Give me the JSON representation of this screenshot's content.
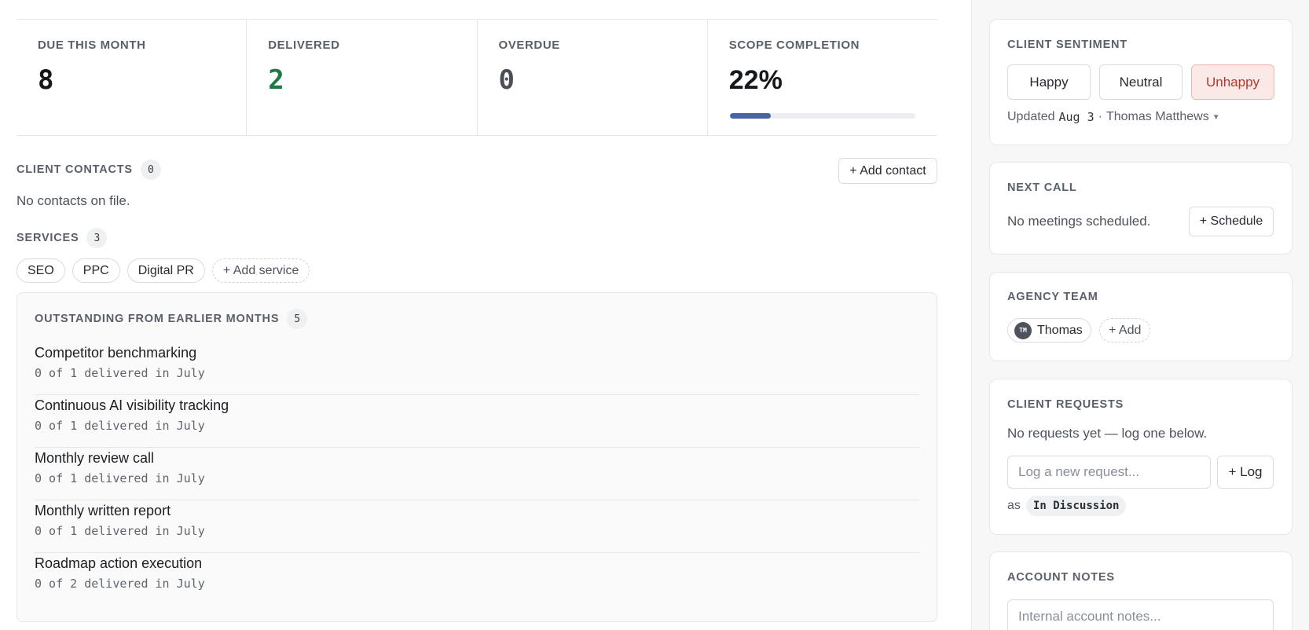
{
  "stats": [
    {
      "label": "DUE THIS MONTH",
      "value": "8",
      "tone": "default"
    },
    {
      "label": "DELIVERED",
      "value": "2",
      "tone": "green"
    },
    {
      "label": "OVERDUE",
      "value": "0",
      "tone": "muted"
    },
    {
      "label": "SCOPE COMPLETION",
      "value": "22%",
      "tone": "default",
      "progress_percent": 22
    }
  ],
  "colors": {
    "delivered_green": "#1c7a48",
    "progress_blue": "#4565a8",
    "unhappy_bg": "#fbe9e7",
    "unhappy_text": "#b3362b"
  },
  "contacts": {
    "title": "CLIENT CONTACTS",
    "count": "0",
    "add_label": "+ Add contact",
    "empty_text": "No contacts on file."
  },
  "services": {
    "title": "SERVICES",
    "count": "3",
    "items": [
      "SEO",
      "PPC",
      "Digital PR"
    ],
    "add_label": "+ Add service"
  },
  "outstanding": {
    "title": "OUTSTANDING FROM EARLIER MONTHS",
    "count": "5",
    "items": [
      {
        "name": "Competitor benchmarking",
        "meta": "0 of 1 delivered in July"
      },
      {
        "name": "Continuous AI visibility tracking",
        "meta": "0 of 1 delivered in July"
      },
      {
        "name": "Monthly review call",
        "meta": "0 of 1 delivered in July"
      },
      {
        "name": "Monthly written report",
        "meta": "0 of 1 delivered in July"
      },
      {
        "name": "Roadmap action execution",
        "meta": "0 of 2 delivered in July"
      }
    ]
  },
  "sentiment": {
    "title": "CLIENT SENTIMENT",
    "options": [
      "Happy",
      "Neutral",
      "Unhappy"
    ],
    "selected": "Unhappy",
    "updated_prefix": "Updated",
    "updated_date": "Aug 3",
    "updated_sep": "·",
    "updated_by": "Thomas Matthews",
    "caret_icon": "caret-down-icon"
  },
  "next_call": {
    "title": "NEXT CALL",
    "empty_text": "No meetings scheduled.",
    "schedule_label": "+ Schedule"
  },
  "team": {
    "title": "AGENCY TEAM",
    "member_initials": "TM",
    "member_name": "Thomas",
    "add_label": "+ Add"
  },
  "requests": {
    "title": "CLIENT REQUESTS",
    "empty_text": "No requests yet — log one below.",
    "input_placeholder": "Log a new request...",
    "log_label": "+ Log",
    "as_label": "as",
    "status": "In Discussion"
  },
  "notes": {
    "title": "ACCOUNT NOTES",
    "placeholder": "Internal account notes..."
  }
}
